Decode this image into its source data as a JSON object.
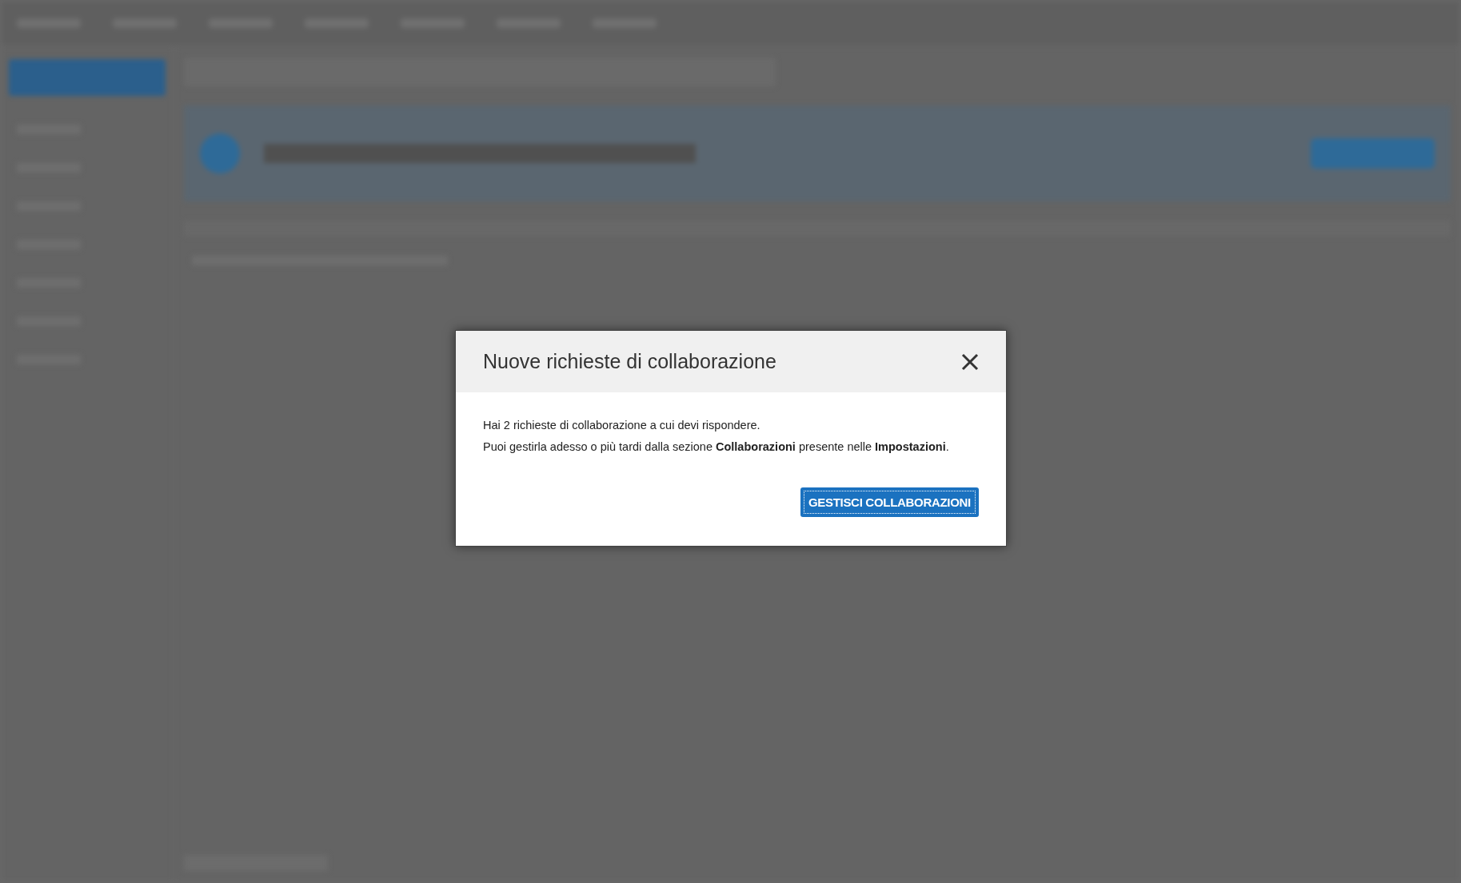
{
  "dialog": {
    "title": "Nuove richieste di collaborazione",
    "message_lines": [
      "Hai 2 richieste di collaborazione a cui devi rispondere.",
      "Puoi gestirla adesso o più tardi dalla sezione **Collaborazioni** presente nelle **Impostazioni**."
    ],
    "button": {
      "label": "GESTISCI COLLABORAZIONI",
      "focused": true
    }
  }
}
